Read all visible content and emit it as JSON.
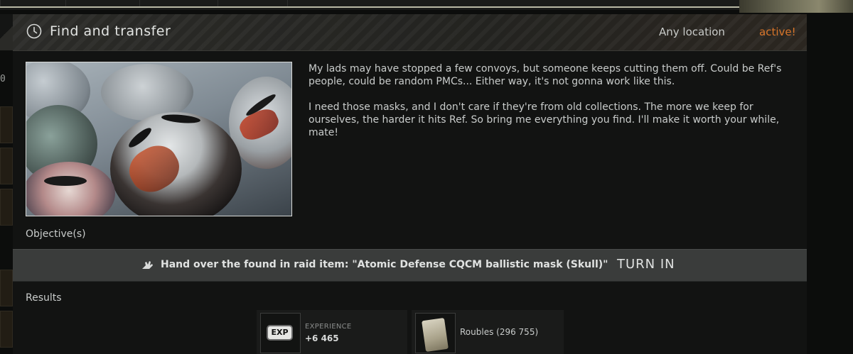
{
  "top_tabs": [
    "",
    "",
    "",
    "",
    ""
  ],
  "side_counter": "0",
  "quest": {
    "title": "Find and transfer",
    "location": "Any location",
    "status": "active!",
    "status_color": "#d9762a"
  },
  "description": [
    "My lads may have stopped a few convoys, but someone keeps cutting them off. Could be Ref's people, could be random PMCs... Either way, it's not gonna work like this.",
    "I need those masks, and I don't care if they're from old collections. The more we keep for ourselves, the harder it hits Ref. So bring me everything you find. I'll make it worth your while, mate!"
  ],
  "objectives": {
    "label": "Objective(s)",
    "items": [
      {
        "icon": "hand-over-icon",
        "text": "Hand over the found in raid item: \"Atomic Defense CQCM ballistic mask (Skull)\"",
        "action": "TURN IN"
      }
    ]
  },
  "results": {
    "label": "Results",
    "rewards": [
      {
        "icon": "exp-icon",
        "badge": "EXP",
        "caption": "EXPERIENCE",
        "value": "+6 465"
      },
      {
        "icon": "roubles-icon",
        "name": "Roubles (296 755)"
      }
    ]
  }
}
